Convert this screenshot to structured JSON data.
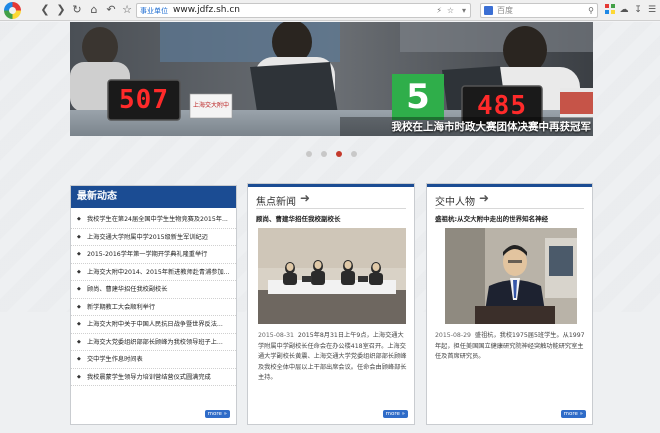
{
  "browser": {
    "url_tag": "事业单位",
    "url": "www.jdfz.sh.cn",
    "search_placeholder": "百度"
  },
  "banner": {
    "caption": "我校在上海市时政大赛团体决赛中再获冠军",
    "left_score": "507",
    "right_score": "485",
    "table_sign": "上海交大附中",
    "center_number": "5",
    "slide_count": 4,
    "active_slide": 3
  },
  "news": {
    "title": "最新动态",
    "items": [
      "我校学生在第24届全国中学生生物竞赛及2015年...",
      "上海交通大学附属中学2015级新生军训纪迈",
      "2015-2016学年第一学期开学典礼隆重举行",
      "上海交大附中2014、2015年新进教师赴青浦参加...",
      "顾尚、曹建华招任我校副校长",
      "新学期教工大会顺利举行",
      "上海交大附中关于中国人民抗日战争暨世界反法...",
      "上海交大党委组织部部长顾峰为我校领导班子上...",
      "交中学生作息时间表",
      "我校晨蒙学生领导力培训营结营仪式圆满完成"
    ],
    "more": "more »"
  },
  "focus": {
    "title": "焦点新闻",
    "arrow": "➜",
    "headline": "顾尚、曹建华招任我校副校长",
    "date": "2015-08-31",
    "body": "2015年8月31日上午9点，上海交通大学附属中学副校长任命会在办公楼418室召开。上海交通大学副校长黄震、上海交通大学党委组织部部长顾峰及我校全体中层以上干部出席会议。任命会由顾峰部长主持。",
    "more": "more »"
  },
  "people": {
    "title": "交中人物",
    "arrow": "➜",
    "headline": "盛祖杭:从交大附中走出的世界知名神经",
    "date": "2015-08-29",
    "body": "盛祖杭，我校1975届5班学生。从1997年起，担任美国国立健康研究院神经突触功能研究室主任及首席研究员。",
    "more": "more »"
  },
  "colors": {
    "accent": "#1b4c93",
    "active_dot": "#c43a2c",
    "more_button": "#2f6cc8"
  }
}
